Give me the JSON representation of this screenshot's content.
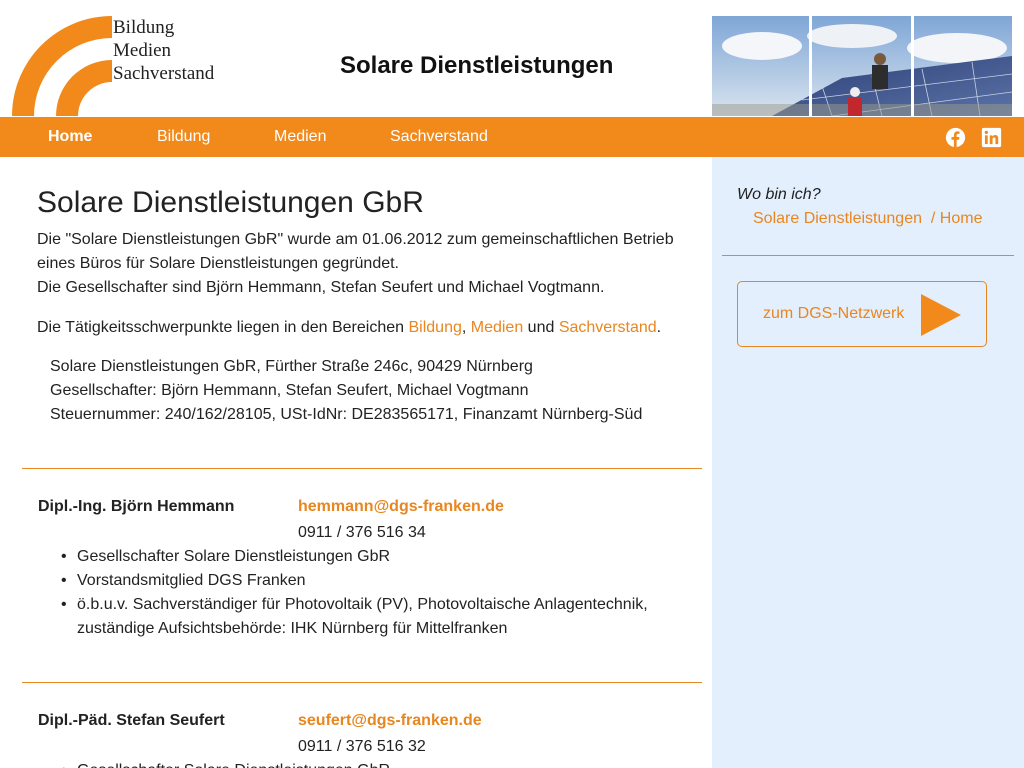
{
  "header": {
    "logo_lines": [
      "Bildung",
      "Medien",
      "Sachverstand"
    ],
    "site_title": "Solare Dienstleistungen"
  },
  "nav": {
    "items": [
      {
        "label": "Home",
        "active": true
      },
      {
        "label": "Bildung",
        "active": false
      },
      {
        "label": "Medien",
        "active": false
      },
      {
        "label": "Sachverstand",
        "active": false
      }
    ],
    "social_icons": [
      "facebook-icon",
      "linkedin-icon"
    ]
  },
  "main": {
    "heading": "Solare Dienstleistungen GbR",
    "intro_lines": [
      "Die \"Solare Dienstleistungen GbR\" wurde am 01.06.2012 zum gemeinschaftlichen Betrieb",
      "eines Büros für Solare Dienstleistungen gegründet.",
      "Die Gesellschafter sind Björn Hemmann, Stefan Seufert und Michael Vogtmann."
    ],
    "focus": {
      "prefix": "Die Tätigkeitsschwerpunkte liegen in den Bereichen ",
      "link1": "Bildung",
      "sep1": ", ",
      "link2": "Medien",
      "sep2": " und ",
      "link3": "Sachverstand",
      "suffix": "."
    },
    "address_lines": [
      "Solare Dienstleistungen GbR, Fürther Straße 246c, 90429 Nürnberg",
      "Gesellschafter: Björn Hemmann, Stefan Seufert, Michael Vogtmann",
      "Steuernummer: 240/162/28105, USt-IdNr: DE283565171, Finanzamt Nürnberg-Süd"
    ],
    "persons": [
      {
        "name": "Dipl.-Ing. Björn Hemmann",
        "email": "hemmann@dgs-franken.de",
        "phone": "0911 / 376 516 34",
        "roles": [
          "Gesellschafter Solare Dienstleistungen GbR",
          "Vorstandsmitglied DGS Franken",
          "ö.b.u.v. Sachverständiger für Photovoltaik (PV), Photovoltaische Anlagentechnik,",
          "zuständige Aufsichtsbehörde: IHK Nürnberg für Mittelfranken"
        ]
      },
      {
        "name": "Dipl.-Päd. Stefan Seufert",
        "email": "seufert@dgs-franken.de",
        "phone": "0911 / 376 516 32",
        "roles": [
          "Gesellschafter Solare Dienstleistungen GbR"
        ]
      }
    ]
  },
  "sidebar": {
    "where_label": "Wo bin ich?",
    "crumb_1": "Solare Dienstleistungen",
    "crumb_sep": "/",
    "crumb_2": "Home",
    "dgs_button": "zum DGS-Netzwerk"
  },
  "colors": {
    "accent": "#f28a1b",
    "link": "#e8861f",
    "sidebar_bg": "#e3effd"
  }
}
